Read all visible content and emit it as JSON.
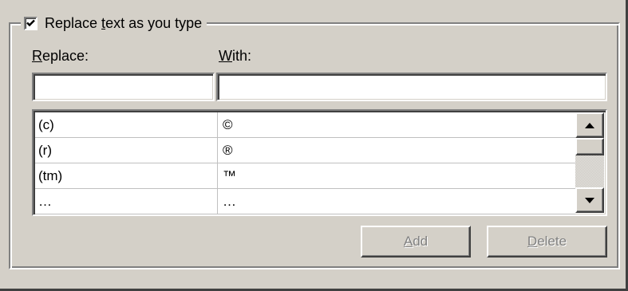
{
  "autocorrect": {
    "replace_as_you_type": {
      "label_before": "Replace ",
      "label_accel": "t",
      "label_after": "ext as you type",
      "checked": true
    },
    "replace_column": {
      "accel": "R",
      "rest": "eplace:",
      "value": ""
    },
    "with_column": {
      "accel": "W",
      "rest": "ith:",
      "value": ""
    },
    "entries": [
      {
        "replace": "(c)",
        "with": "©"
      },
      {
        "replace": "(r)",
        "with": "®"
      },
      {
        "replace": "(tm)",
        "with": "™"
      },
      {
        "replace": "…",
        "with": "…"
      }
    ],
    "buttons": {
      "add": {
        "accel": "A",
        "rest": "dd",
        "enabled": false
      },
      "delete": {
        "accel": "D",
        "rest": "elete",
        "enabled": false
      }
    }
  },
  "icons": {
    "checkmark": "checkmark-icon",
    "scroll_up": "arrow-up-icon",
    "scroll_down": "arrow-down-icon"
  }
}
